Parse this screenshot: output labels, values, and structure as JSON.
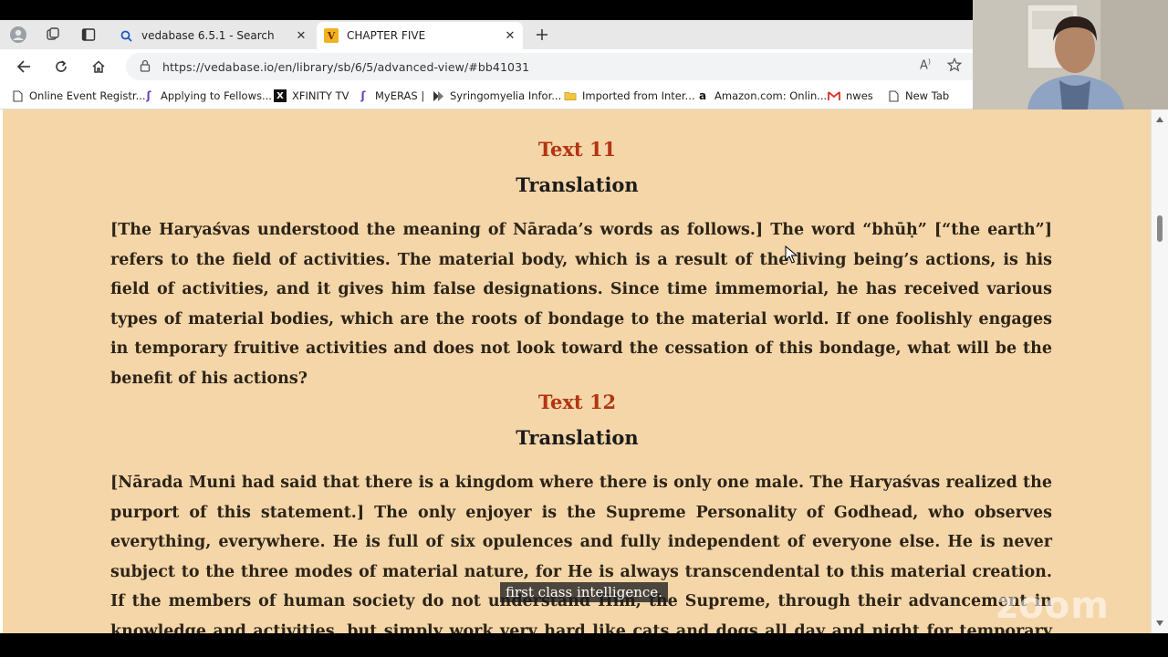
{
  "browser": {
    "tabs": [
      {
        "title": "vedabase 6.5.1 - Search",
        "active": false,
        "icon": "search-icon"
      },
      {
        "title": "CHAPTER FIVE",
        "active": true,
        "icon": "vedabase-v-logo",
        "favicon_letter": "V"
      }
    ],
    "url": "https://vedabase.io/en/library/sb/6/5/advanced-view/#bb41031",
    "bookmarks": [
      {
        "label": "Online Event Registr...",
        "icon": "page-icon"
      },
      {
        "label": "Applying to Fellows...",
        "icon": "purple-s-icon"
      },
      {
        "label": "XFINITY TV",
        "icon": "x-icon"
      },
      {
        "label": "MyERAS |",
        "icon": "purple-s-icon"
      },
      {
        "label": "Syringomyelia Infor...",
        "icon": "arrow-icon"
      },
      {
        "label": "Imported from Inter...",
        "icon": "folder-icon"
      },
      {
        "label": "Amazon.com: Onlin...",
        "icon": "amazon-icon"
      },
      {
        "label": "nwes",
        "icon": "gmail-icon"
      },
      {
        "label": "New Tab",
        "icon": "page-icon"
      }
    ]
  },
  "content": {
    "sections": [
      {
        "text_label": "Text 11",
        "translation_label": "Translation",
        "paragraph": "[The Haryaśvas understood the meaning of Nārada’s words as follows.] The word “bhūḥ” [“the earth”] refers to the field of activities. The material body, which is a result of the living being’s actions, is his field of activities, and it gives him false designations. Since time immemorial, he has received various types of material bodies, which are the roots of bondage to the material world. If one foolishly engages in temporary fruitive activities and does not look toward the cessation of this bondage, what will be the benefit of his actions?"
      },
      {
        "text_label": "Text 12",
        "translation_label": "Translation",
        "paragraph": "[Nārada Muni had said that there is a kingdom where there is only one male. The Haryaśvas realized the purport of this statement.] The only enjoyer is the Supreme Personality of Godhead, who observes everything, everywhere. He is full of six opulences and fully independent of everyone else. He is never subject to the three modes of material nature, for He is always transcendental to this material creation. If the members of human society do not understand Him, the Supreme, through their advancement in knowledge and activities, but simply work very hard like cats and dogs all day and night for temporary happiness, what will be the benefit of their"
      }
    ]
  },
  "overlay": {
    "caption": "first class intelligence.",
    "watermark": "zoom"
  },
  "colors": {
    "page_background": "#f5d6a8",
    "text_heading": "#b23512",
    "body_text": "#2c2418"
  }
}
